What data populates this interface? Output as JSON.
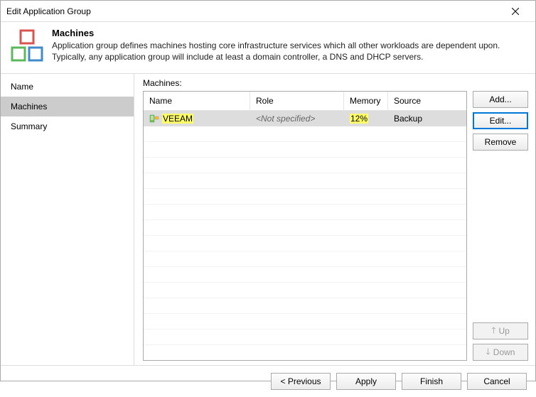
{
  "window": {
    "title": "Edit Application Group"
  },
  "header": {
    "heading": "Machines",
    "desc1": "Application group defines machines hosting core infrastructure services which all other workloads are dependent upon.",
    "desc2": "Typically, any application group will include at least a domain controller, a DNS and DHCP servers."
  },
  "sidebar": {
    "items": [
      {
        "label": "Name"
      },
      {
        "label": "Machines"
      },
      {
        "label": "Summary"
      }
    ]
  },
  "content": {
    "label": "Machines:",
    "columns": {
      "name": "Name",
      "role": "Role",
      "memory": "Memory",
      "source": "Source"
    },
    "row": {
      "name": "VEEAM",
      "role": "<Not specified>",
      "memory": "12%",
      "source": "Backup"
    }
  },
  "buttons": {
    "add": "Add...",
    "edit": "Edit...",
    "remove": "Remove",
    "up": "Up",
    "down": "Down"
  },
  "footer": {
    "previous": "< Previous",
    "apply": "Apply",
    "finish": "Finish",
    "cancel": "Cancel"
  }
}
